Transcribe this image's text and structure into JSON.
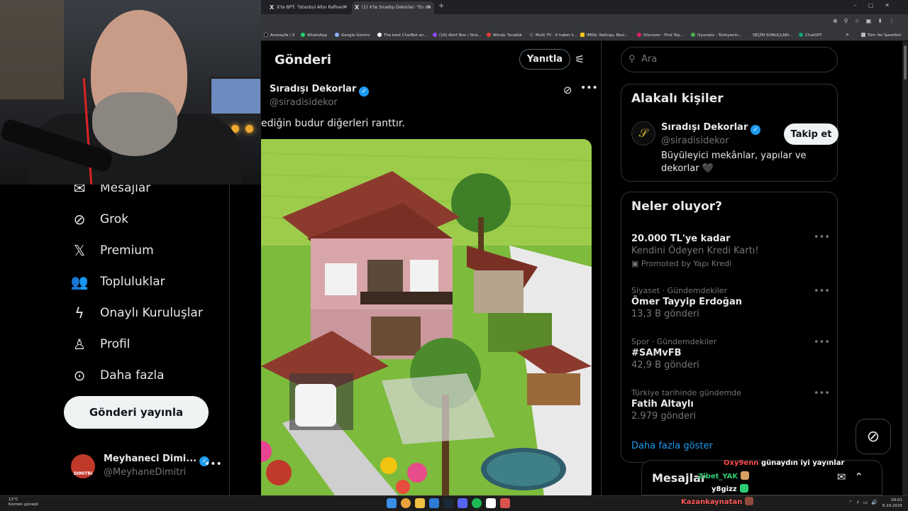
{
  "browser": {
    "tabs": [
      {
        "label": "X'te BPT: \"İstanbul Altın Rafineri"
      },
      {
        "label": "(1) X'te Sıradışı Dekorlar: \"Ev de"
      }
    ],
    "new_tab": "+",
    "bookmarks": [
      "Anasayfa / X",
      "WhatsApp",
      "Google Gemini",
      "The best ChatBot an...",
      "(19) Alert Box / Stre...",
      "Windy: Sıcaklık",
      "Multi TV - 6 haber k...",
      "IMDb: Ratings, Revi...",
      "Discover - Find Top...",
      "Oyuneks - Türkiyenin...",
      "SEÇİM SONUÇLARI...",
      "ChatGPT"
    ],
    "bookmarks_overflow": "»",
    "all_bookmarks": "Tüm Yer İşaretleri"
  },
  "nav": {
    "items": [
      {
        "label": "Mesajlar",
        "icon": "mail-icon"
      },
      {
        "label": "Grok",
        "icon": "grok-icon"
      },
      {
        "label": "Premium",
        "icon": "x-logo-icon"
      },
      {
        "label": "Topluluklar",
        "icon": "communities-icon"
      },
      {
        "label": "Onaylı Kuruluşlar",
        "icon": "lightning-icon"
      },
      {
        "label": "Profil",
        "icon": "profile-icon"
      },
      {
        "label": "Daha fazla",
        "icon": "more-circle-icon"
      }
    ],
    "post_button": "Gönderi yayınla",
    "account": {
      "name": "Meyhaneci Dimi...",
      "handle": "@MeyhaneDimitri",
      "avatar_text": "DIMITRI"
    }
  },
  "main": {
    "title": "Gönderi",
    "reply_button": "Yanıtla",
    "post": {
      "author_name": "Sıradışı Dekorlar",
      "author_handle": "@siradisidekor",
      "text": "ediğin budur diğerleri ranttır."
    }
  },
  "sidebar": {
    "search_placeholder": "Ara",
    "related": {
      "title": "Alakalı kişiler",
      "name": "Sıradışı Dekorlar",
      "handle": "@siradisidekor",
      "bio": "Büyüleyici mekânlar, yapılar ve dekorlar 🖤",
      "follow_button": "Takip et"
    },
    "trends": {
      "title": "Neler oluyor?",
      "items": [
        {
          "meta": "",
          "title": "20.000 TL'ye kadar",
          "sub": "Kendini Ödeyen Kredi Kartı!",
          "promo": "Promoted by Yapı Kredi"
        },
        {
          "meta": "Siyaset · Gündemdekiler",
          "title": "Ömer Tayyip Erdoğan",
          "sub": "13,3 B gönderi",
          "promo": ""
        },
        {
          "meta": "Spor · Gündemdekiler",
          "title": "#SAMvFB",
          "sub": "42,9 B gönderi",
          "promo": ""
        },
        {
          "meta": "Türkiye tarihinde gündemde",
          "title": "Fatih Altaylı",
          "sub": "2.979 gönderi",
          "promo": ""
        }
      ],
      "show_more": "Daha fazla göster"
    }
  },
  "messages_drawer": {
    "title": "Mesajlar"
  },
  "stream_chat": [
    {
      "user": "Oxy9enn",
      "message": "günaydın iyi yayınlar",
      "color": "#ff4d4d"
    },
    {
      "user": "Zibet_YAK",
      "message": "",
      "color": "#2ecc71"
    },
    {
      "user": "y8gizz",
      "message": "",
      "color": "#ffffff"
    },
    {
      "user": "Kazankaynatan",
      "message": "",
      "color": "#ff5a5a"
    }
  ],
  "taskbar": {
    "weather_temp": "12°C",
    "weather_desc": "Kısmen güneşli",
    "time": "09:01",
    "date": "6.10.2025"
  },
  "colors": {
    "accent": "#1d9bf0",
    "background": "#000000",
    "border": "#2f3336"
  }
}
